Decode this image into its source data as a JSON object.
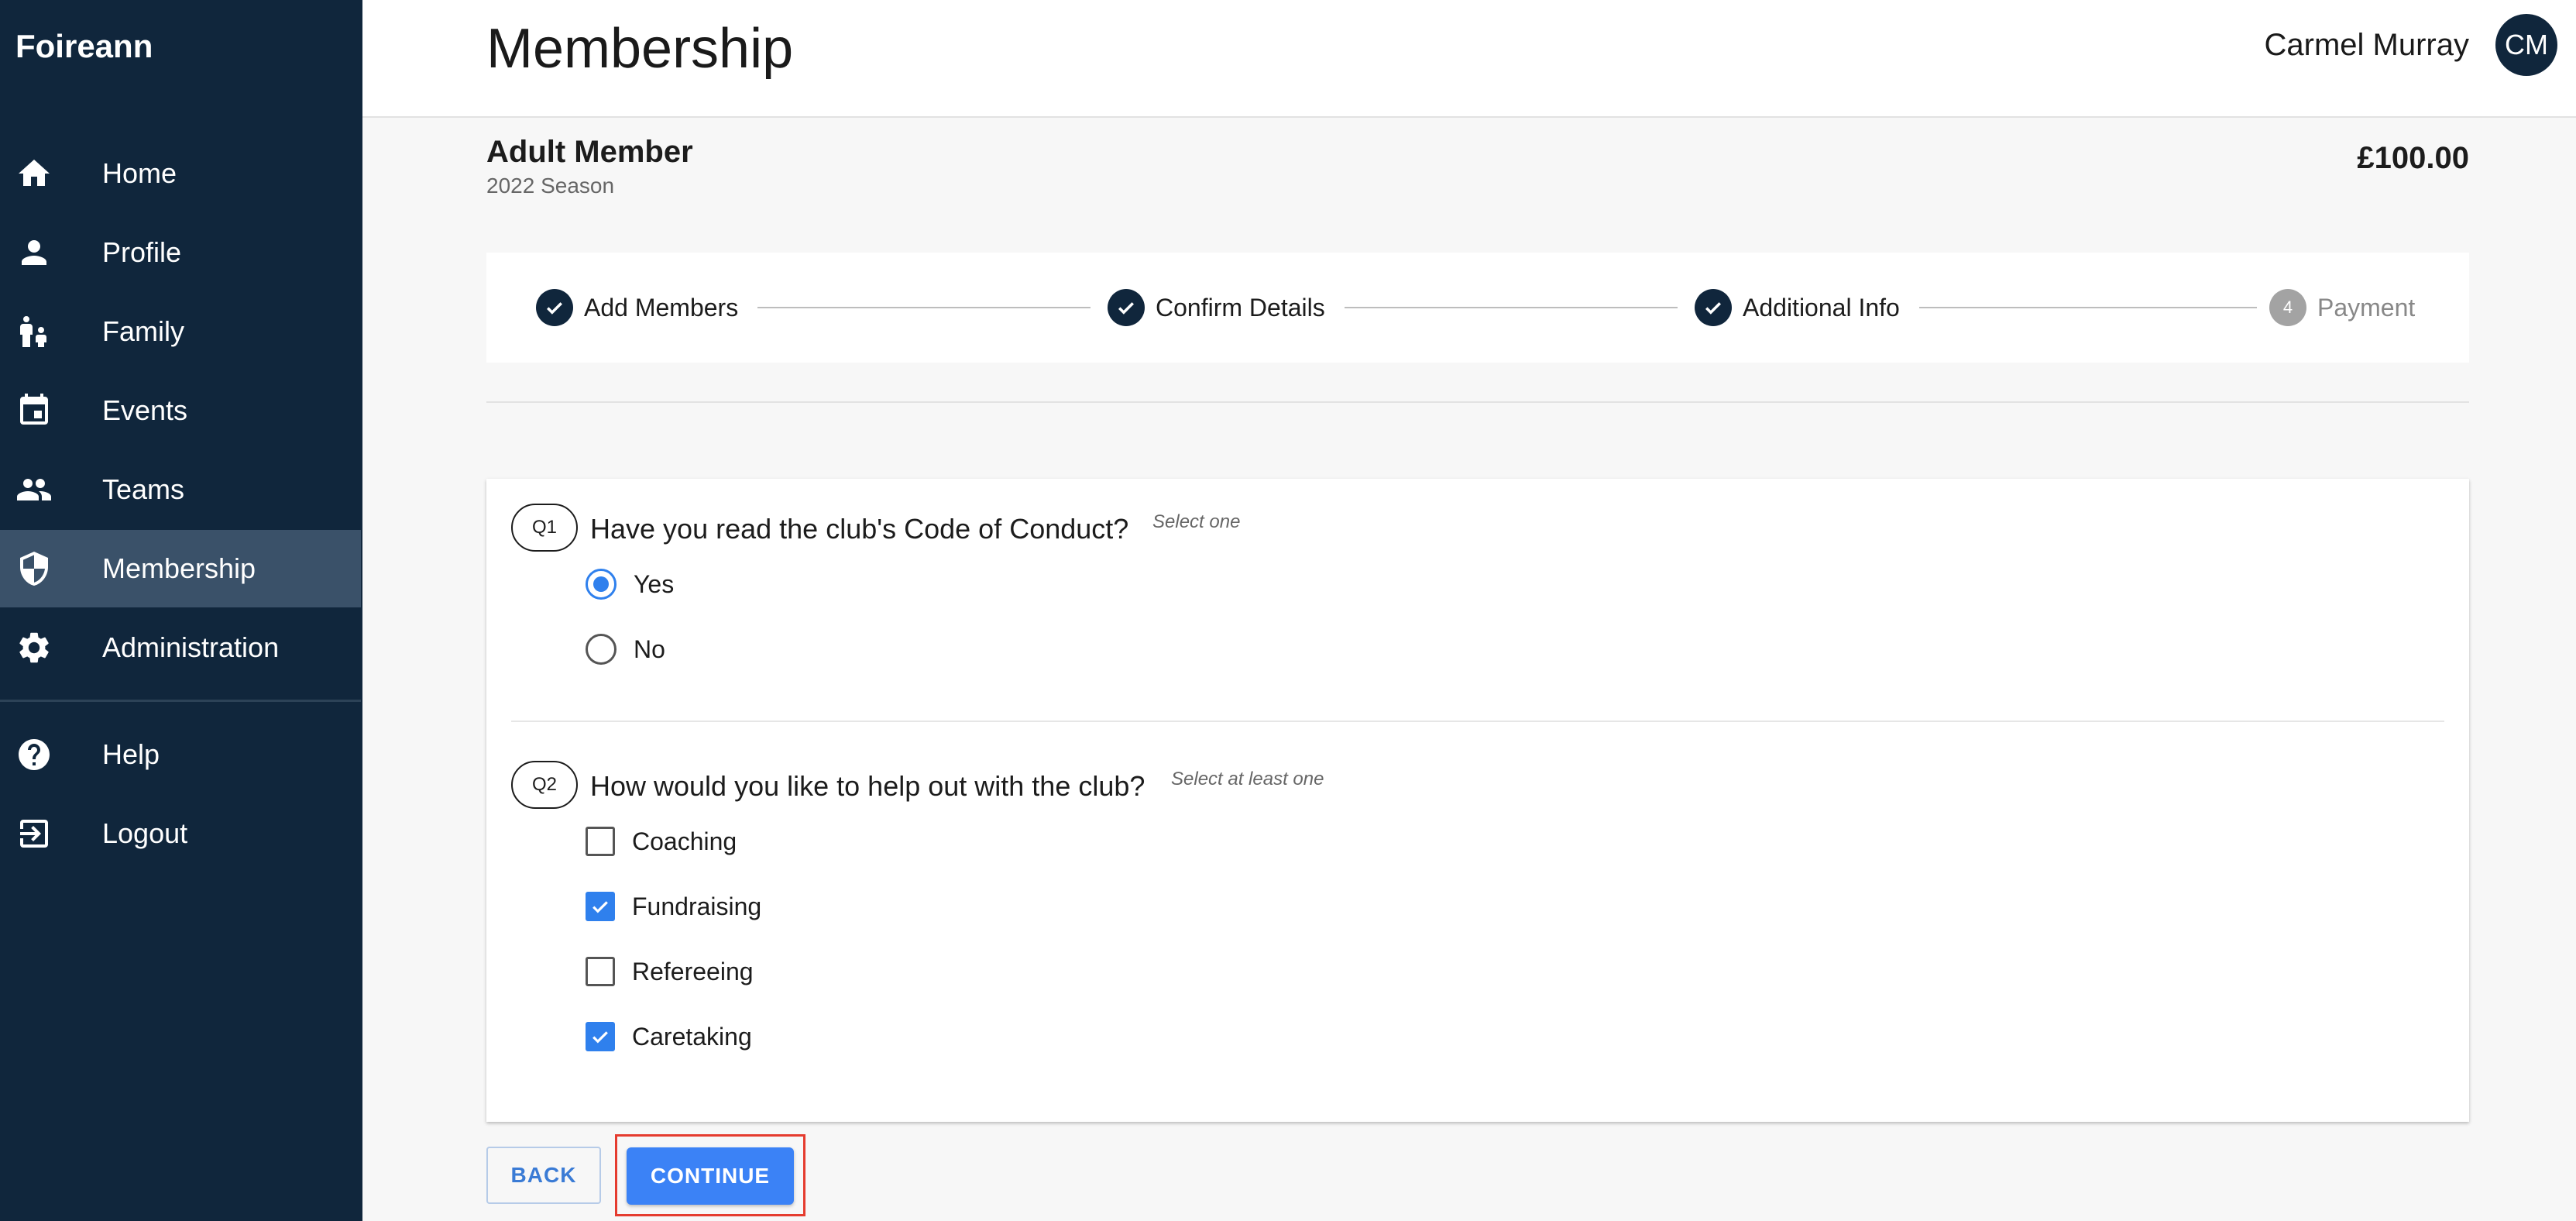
{
  "app": {
    "brand": "Foireann"
  },
  "sidebar": {
    "items": [
      {
        "label": "Home",
        "icon": "home-icon"
      },
      {
        "label": "Profile",
        "icon": "person-icon"
      },
      {
        "label": "Family",
        "icon": "family-icon"
      },
      {
        "label": "Events",
        "icon": "calendar-icon"
      },
      {
        "label": "Teams",
        "icon": "people-icon"
      },
      {
        "label": "Membership",
        "icon": "shield-icon",
        "active": true
      },
      {
        "label": "Administration",
        "icon": "gear-icon"
      }
    ],
    "bottom_items": [
      {
        "label": "Help",
        "icon": "help-icon"
      },
      {
        "label": "Logout",
        "icon": "logout-icon"
      }
    ]
  },
  "header": {
    "title": "Membership",
    "user_name": "Carmel Murray",
    "user_initials": "CM"
  },
  "membership": {
    "title": "Adult Member",
    "season": "2022 Season",
    "price": "£100.00"
  },
  "stepper": {
    "steps": [
      {
        "label": "Add Members",
        "status": "complete"
      },
      {
        "label": "Confirm Details",
        "status": "complete"
      },
      {
        "label": "Additional Info",
        "status": "complete"
      },
      {
        "label": "Payment",
        "status": "pending",
        "number": "4"
      }
    ]
  },
  "questions": [
    {
      "badge": "Q1",
      "text": "Have you read the club's Code of Conduct?",
      "hint": "Select one",
      "type": "radio",
      "options": [
        {
          "label": "Yes",
          "checked": true
        },
        {
          "label": "No",
          "checked": false
        }
      ]
    },
    {
      "badge": "Q2",
      "text": "How would you like to help out with the club?",
      "hint": "Select at least one",
      "type": "checkbox",
      "options": [
        {
          "label": "Coaching",
          "checked": false
        },
        {
          "label": "Fundraising",
          "checked": true
        },
        {
          "label": "Refereeing",
          "checked": false
        },
        {
          "label": "Caretaking",
          "checked": true
        }
      ]
    }
  ],
  "actions": {
    "back_label": "BACK",
    "continue_label": "CONTINUE"
  },
  "colors": {
    "sidebar_bg": "#10263c",
    "sidebar_active": "#3a5169",
    "accent": "#3b82f6",
    "highlight_border": "#e53c2f"
  }
}
